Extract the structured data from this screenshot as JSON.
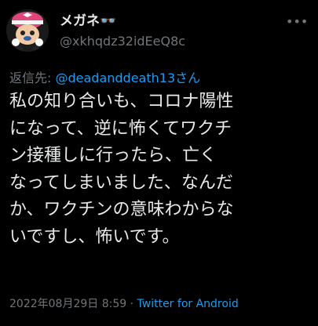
{
  "user": {
    "display_name": "メガネ👓",
    "handle": "@xkhqdz32idEeQ8c",
    "avatar_icon": "anime-avatar-icon"
  },
  "reply": {
    "prefix": "返信先: ",
    "target": "@deadanddeath13さん"
  },
  "body": {
    "lines": [
      "私の知り合いも、コロナ陽性",
      "になって、逆に怖くてワクチ",
      "ン接種しに行ったら、亡く",
      "なってしまいました、なんだ",
      "か、ワクチンの意味わからな",
      "いですし、怖いです。"
    ]
  },
  "meta": {
    "timestamp": "2022年08月29日 8:59",
    "separator": " · ",
    "source": "Twitter for Android"
  },
  "more_icon": "more-horizontal-icon",
  "colors": {
    "background": "#000000",
    "text": "#e7e9ea",
    "secondary": "#71767b",
    "link": "#1d9bf0"
  }
}
